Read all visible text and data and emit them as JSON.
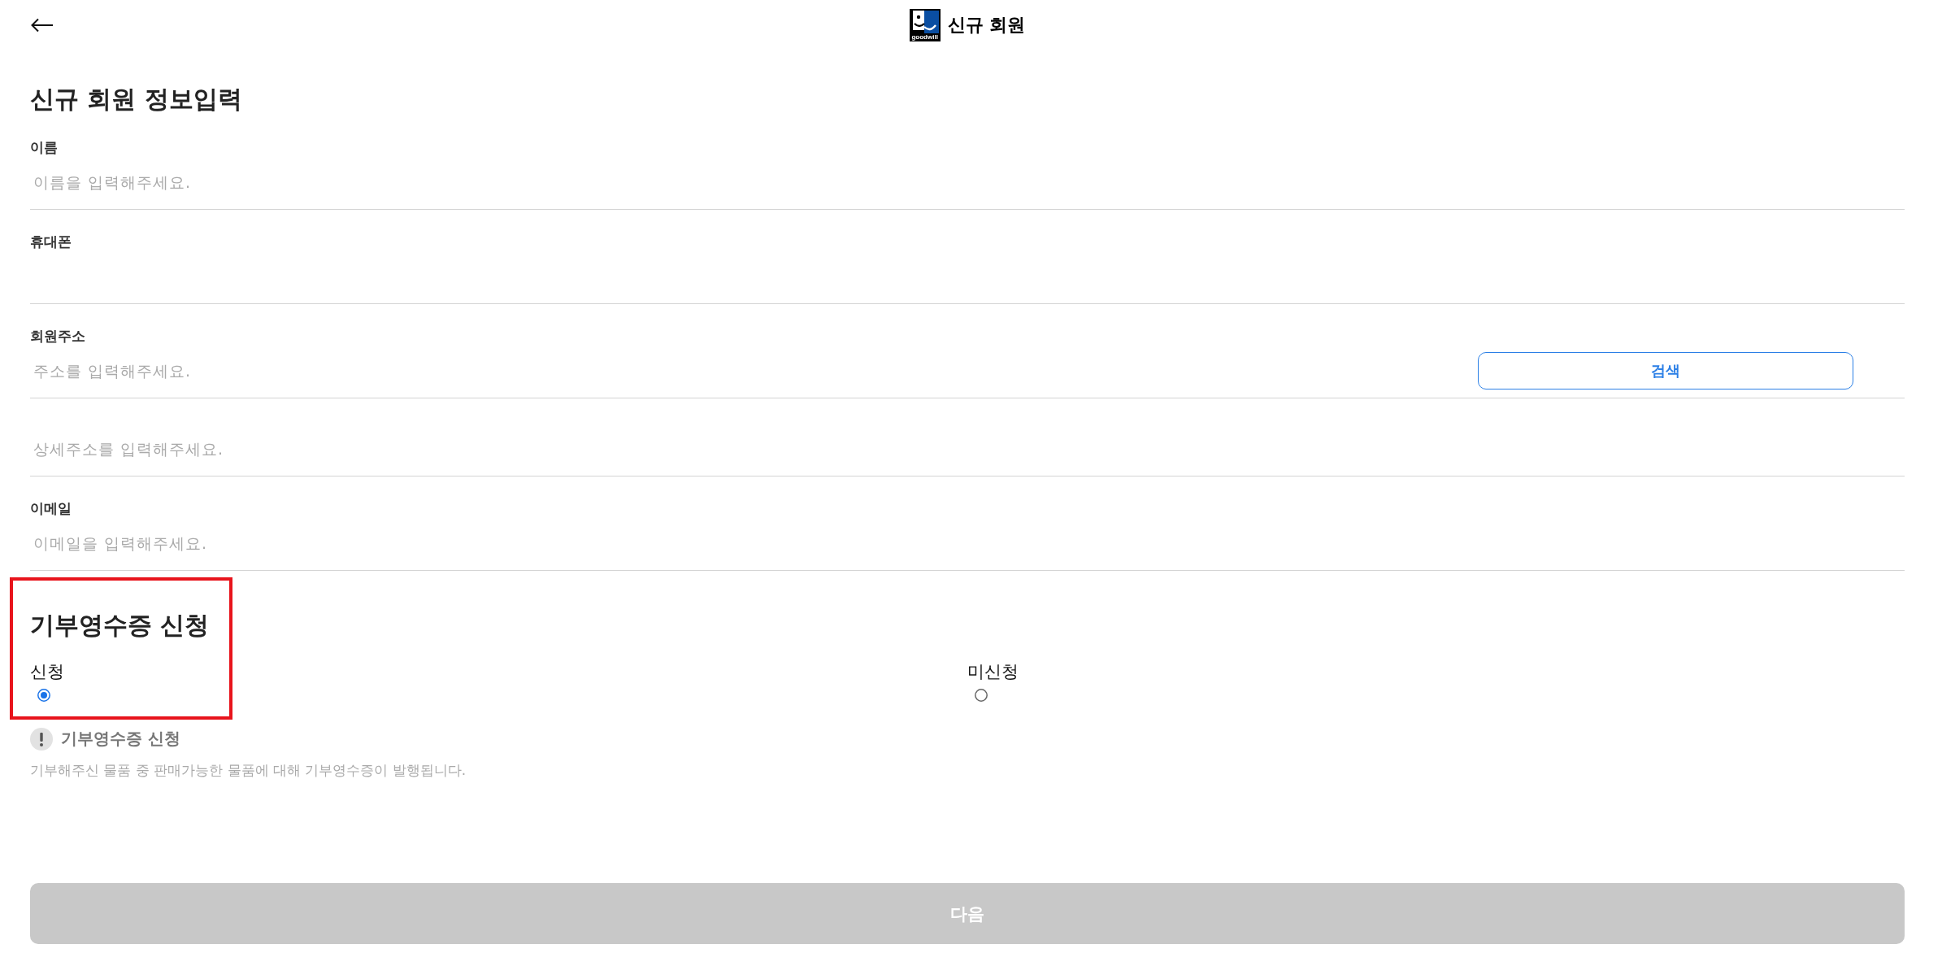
{
  "header": {
    "title": "신규 회원",
    "logo_text": "goodwill"
  },
  "form": {
    "title": "신규 회원 정보입력",
    "fields": [
      {
        "label": "이름",
        "placeholder": "이름을 입력해주세요."
      },
      {
        "label": "휴대폰"
      },
      {
        "label": "회원주소",
        "placeholder": "주소를 입력해주세요.",
        "button": "검색"
      },
      {
        "placeholder": "상세주소를 입력해주세요."
      },
      {
        "label": "이메일",
        "placeholder": "이메일을 입력해주세요."
      }
    ]
  },
  "receipt": {
    "title": "기부영수증 신청",
    "highlighted": true,
    "options": [
      {
        "label": "신청",
        "selected": true
      },
      {
        "label": "미신청",
        "selected": false
      }
    ],
    "notice": {
      "title": "기부영수증 신청",
      "text": "기부해주신 물품 중 판매가능한 물품에 대해 기부영수증이 발행됩니다."
    }
  },
  "next_button": {
    "label": "다음",
    "disabled": true
  }
}
